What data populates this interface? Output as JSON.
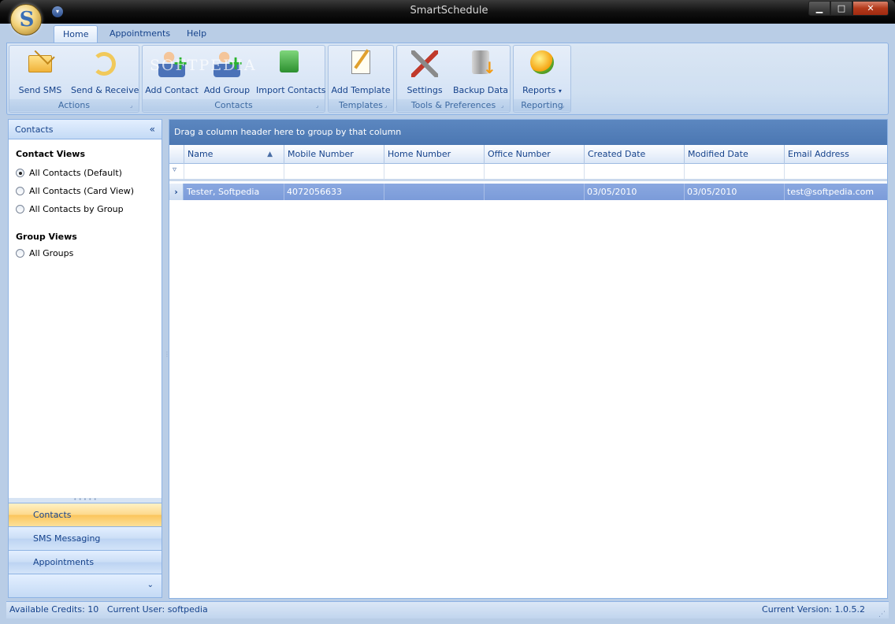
{
  "window": {
    "title": "SmartSchedule",
    "controls": {
      "minimize": "▁",
      "maximize": "□",
      "close": "✕"
    }
  },
  "app_logo": "S",
  "ribbon": {
    "tabs": [
      {
        "label": "Home",
        "active": true
      },
      {
        "label": "Appointments",
        "active": false
      },
      {
        "label": "Help",
        "active": false
      }
    ],
    "groups": {
      "actions": {
        "label": "Actions",
        "buttons": [
          {
            "label": "Send SMS",
            "icon": "envelope-icon"
          },
          {
            "label": "Send & Receive",
            "icon": "sync-icon"
          }
        ]
      },
      "contacts": {
        "label": "Contacts",
        "buttons": [
          {
            "label": "Add Contact",
            "icon": "add-contact-icon"
          },
          {
            "label": "Add Group",
            "icon": "add-group-icon"
          },
          {
            "label": "Import Contacts",
            "icon": "import-icon"
          }
        ]
      },
      "templates": {
        "label": "Templates",
        "buttons": [
          {
            "label": "Add Template",
            "icon": "template-icon"
          }
        ]
      },
      "tools": {
        "label": "Tools & Preferences",
        "buttons": [
          {
            "label": "Settings",
            "icon": "tools-icon"
          },
          {
            "label": "Backup Data",
            "icon": "backup-icon"
          }
        ]
      },
      "reporting": {
        "label": "Reporting",
        "buttons": [
          {
            "label": "Reports",
            "icon": "reports-icon"
          }
        ]
      }
    },
    "watermark": "SOFTPEDIA"
  },
  "nav": {
    "header": "Contacts",
    "collapse_glyph": "«",
    "contact_views_title": "Contact Views",
    "contact_views": [
      {
        "label": "All Contacts (Default)",
        "selected": true
      },
      {
        "label": "All Contacts (Card View)",
        "selected": false
      },
      {
        "label": "All Contacts by Group",
        "selected": false
      }
    ],
    "group_views_title": "Group Views",
    "group_views": [
      {
        "label": "All Groups",
        "selected": false
      }
    ],
    "buttons": [
      {
        "label": "Contacts",
        "active": true
      },
      {
        "label": "SMS Messaging",
        "active": false
      },
      {
        "label": "Appointments",
        "active": false
      }
    ],
    "footer_glyph": "⌄"
  },
  "grid": {
    "group_panel_hint": "Drag a column header here to group by that column",
    "columns": [
      "Name",
      "Mobile Number",
      "Home Number",
      "Office Number",
      "Created Date",
      "Modified Date",
      "Email Address"
    ],
    "sort_indicator": "▲",
    "rows": [
      [
        "Tester, Softpedia",
        "4072056633",
        "",
        "",
        "03/05/2010",
        "03/05/2010",
        "test@softpedia.com"
      ]
    ]
  },
  "status": {
    "credits": "Available Credits: 10",
    "user": "Current User: softpedia",
    "version": "Current Version: 1.0.5.2"
  }
}
